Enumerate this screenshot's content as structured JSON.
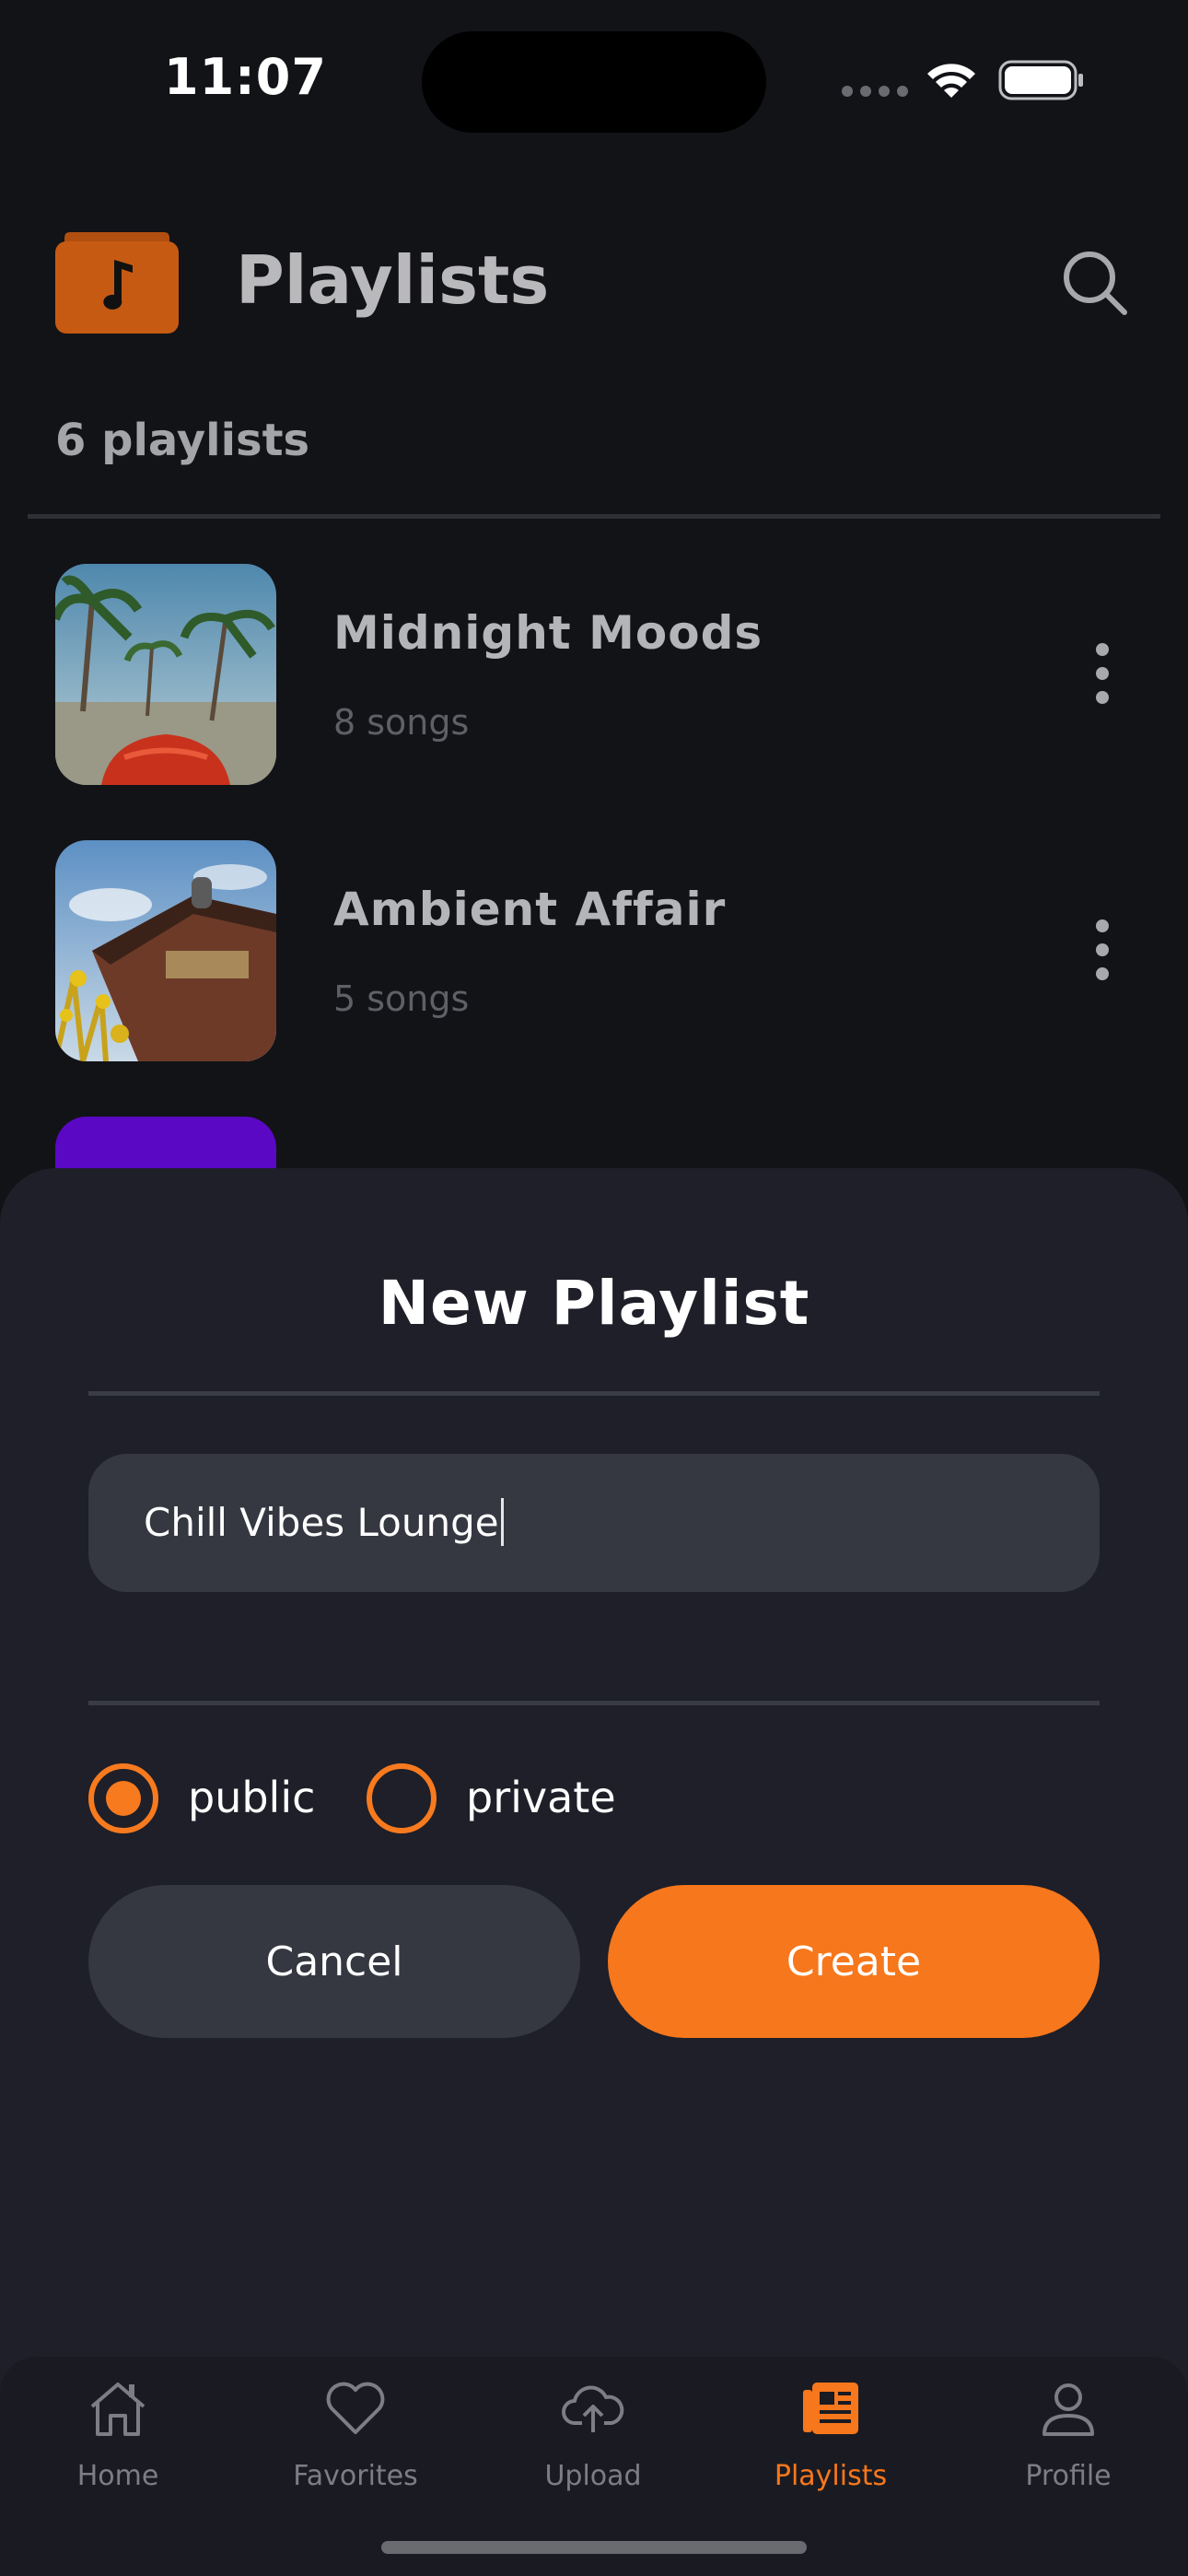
{
  "status_bar": {
    "time": "11:07"
  },
  "header": {
    "title": "Playlists",
    "count_label": "6 playlists"
  },
  "playlists": [
    {
      "title": "Midnight Moods",
      "subtitle": "8 songs"
    },
    {
      "title": "Ambient Affair",
      "subtitle": "5 songs"
    }
  ],
  "sheet": {
    "title": "New Playlist",
    "name_value": "Chill Vibes Lounge",
    "visibility_options": [
      "public",
      "private"
    ],
    "selected_visibility": "public",
    "cancel_label": "Cancel",
    "create_label": "Create"
  },
  "tab_bar": {
    "tabs": [
      {
        "label": "Home",
        "icon": "home-icon"
      },
      {
        "label": "Favorites",
        "icon": "heart-icon"
      },
      {
        "label": "Upload",
        "icon": "cloud-upload-icon"
      },
      {
        "label": "Playlists",
        "icon": "playlists-icon"
      },
      {
        "label": "Profile",
        "icon": "profile-icon"
      }
    ],
    "active": "Playlists"
  },
  "colors": {
    "accent": "#f7771c",
    "background": "#121317",
    "sheet": "#1e1f28"
  }
}
